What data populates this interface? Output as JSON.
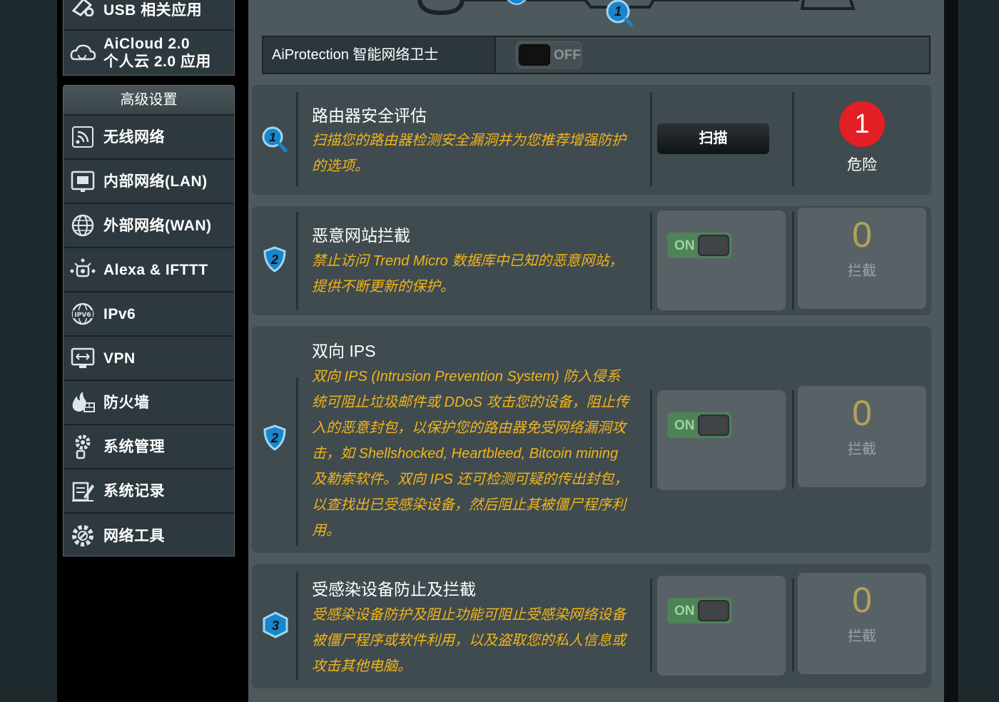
{
  "sidebar": {
    "top_items": [
      {
        "label": "USB 相关应用",
        "icon": "usb-icon"
      },
      {
        "label_line1": "AiCloud 2.0",
        "label_line2": "个人云 2.0 应用",
        "icon": "cloud-icon"
      }
    ],
    "advanced_header": "高级设置",
    "items": [
      {
        "label": "无线网络",
        "icon": "wireless-icon"
      },
      {
        "label": "内部网络(LAN)",
        "icon": "lan-icon"
      },
      {
        "label": "外部网络(WAN)",
        "icon": "wan-globe-icon"
      },
      {
        "label": "Alexa & IFTTT",
        "icon": "alexa-icon"
      },
      {
        "label": "IPv6",
        "icon": "ipv6-icon"
      },
      {
        "label": "VPN",
        "icon": "vpn-icon"
      },
      {
        "label": "防火墙",
        "icon": "firewall-icon"
      },
      {
        "label": "系统管理",
        "icon": "admin-gear-icon"
      },
      {
        "label": "系统记录",
        "icon": "log-icon"
      },
      {
        "label": "网络工具",
        "icon": "network-tools-icon"
      }
    ]
  },
  "stepper": {
    "step1": "1"
  },
  "aiprotection": {
    "title": "AiProtection 智能网络卫士",
    "toggle_state": "OFF"
  },
  "panels": {
    "router_assessment": {
      "badge": "1",
      "title": "路由器安全评估",
      "desc_line1": "扫描您的路由器检测安全漏洞并为您推荐增强防护",
      "desc_line2": "的选项。",
      "scan_label": "扫描",
      "risk_count": "1",
      "risk_label": "危险"
    },
    "malicious_sites": {
      "badge": "2",
      "title": "恶意网站拦截",
      "desc_line1": "禁止访问 Trend Micro 数据库中已知的恶意网站，",
      "desc_line2": "提供不断更新的保护。",
      "toggle": "ON",
      "count": "0",
      "count_label": "拦截"
    },
    "two_way_ips": {
      "badge": "2",
      "title": "双向 IPS",
      "desc_lines": [
        "双向 IPS (Intrusion Prevention System) 防入侵系",
        "统可阻止垃圾邮件或 DDoS 攻击您的设备，阻止传",
        "入的恶意封包，以保护您的路由器免受网络漏洞攻",
        "击，如 Shellshocked, Heartbleed, Bitcoin mining",
        "及勒索软件。双向 IPS 还可检测可疑的传出封包，",
        "以查找出已受感染设备，然后阻止其被僵尸程序利",
        "用。"
      ],
      "toggle": "ON",
      "count": "0",
      "count_label": "拦截"
    },
    "infected_device": {
      "badge": "3",
      "title": "受感染设备防止及拦截",
      "desc_lines": [
        "受感染设备防护及阻止功能可阻止受感染网络设备",
        "被僵尸程序或软件利用，以及盗取您的私人信息或",
        "攻击其他电脑。"
      ],
      "toggle": "ON",
      "count": "0",
      "count_label": "拦截"
    }
  },
  "colors": {
    "accent_orange": "#f2b41a",
    "danger_red": "#e41e25",
    "on_green": "#4e8257",
    "badge_blue": "#1a85c8"
  }
}
